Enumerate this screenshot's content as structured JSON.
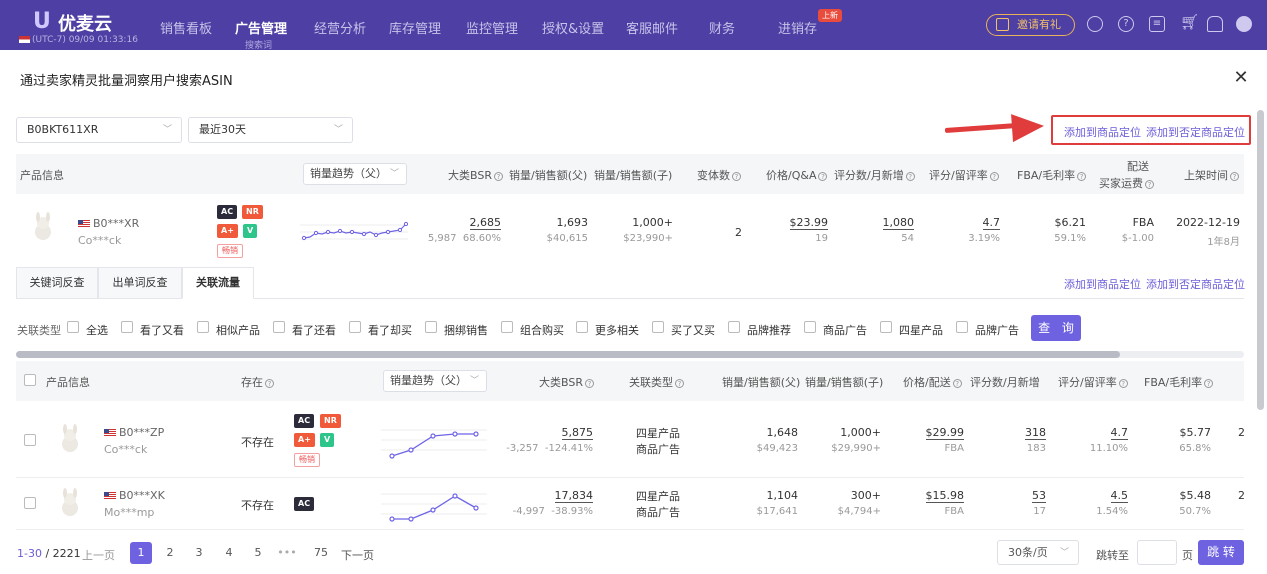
{
  "nav": {
    "brand": "优麦云",
    "clock": "(UTC-7) 09/09 01:33:16",
    "items": [
      "销售看板",
      "广告管理",
      "经营分析",
      "库存管理",
      "监控管理",
      "授权&设置",
      "客服邮件",
      "财务",
      "进销存"
    ],
    "active_sub": "搜索词",
    "new_badge": "上新",
    "invite": "邀请有礼"
  },
  "modal": {
    "title": "通过卖家精灵批量洞察用户搜索ASIN",
    "asin_select": "B0BKT611XR",
    "range_select": "最近30天",
    "link_add": "添加到商品定位",
    "link_add_neg": "添加到否定商品定位"
  },
  "product_header": {
    "info": "产品信息",
    "trend": "销量趋势（父）",
    "bsr": "大类BSR",
    "sales_parent": "销量/销售额(父)",
    "sales_child": "销量/销售额(子)",
    "variants": "变体数",
    "price": "价格/Q&A",
    "reviews": "评分数/月新增",
    "rating": "评分/留评率",
    "fba": "FBA/毛利率",
    "ship_1": "配送",
    "ship_2": "买家运费",
    "date": "上架时间"
  },
  "product": {
    "id": "B0***XR",
    "brand": "Co***ck",
    "badges": [
      "AC",
      "NR",
      "A+",
      "V",
      "畅销"
    ],
    "bsr": "2,685",
    "bsr_delta": "5,987",
    "bsr_pct": "68.60%",
    "sales_parent": "1,693",
    "rev_parent": "$40,615",
    "sales_child": "1,000+",
    "rev_child": "$23,990+",
    "variants": "2",
    "price": "$23.99",
    "qa": "19",
    "reviews": "1,080",
    "reviews_new": "54",
    "rating": "4.7",
    "review_rate": "3.19%",
    "fba": "$6.21",
    "margin": "59.1%",
    "ship": "FBA",
    "ship_fee": "$-1.00",
    "date": "2022-12-19",
    "age": "1年8月"
  },
  "tabs": [
    "关键词反查",
    "出单词反查",
    "关联流量"
  ],
  "filters": {
    "label": "关联类型",
    "options": [
      "全选",
      "看了又看",
      "相似产品",
      "看了还看",
      "看了却买",
      "捆绑销售",
      "组合购买",
      "更多相关",
      "买了又买",
      "品牌推荐",
      "商品广告",
      "四星产品",
      "品牌广告"
    ],
    "query": "查 询"
  },
  "list_header": {
    "info": "产品信息",
    "exists": "存在",
    "trend": "销量趋势（父）",
    "bsr": "大类BSR",
    "rel": "关联类型",
    "sales_parent": "销量/销售额(父)",
    "sales_child": "销量/销售额(子)",
    "price": "价格/配送",
    "reviews": "评分数/月新增",
    "rating": "评分/留评率",
    "fba": "FBA/毛利率"
  },
  "rows": [
    {
      "id": "B0***ZP",
      "brand": "Co***ck",
      "exists": "不存在",
      "bsr": "5,875",
      "bsr_delta": "-3,257",
      "bsr_pct": "-124.41%",
      "rel1": "四星产品",
      "rel2": "商品广告",
      "sales_parent": "1,648",
      "rev_parent": "$49,423",
      "sales_child": "1,000+",
      "rev_child": "$29,990+",
      "price": "$29.99",
      "ship": "FBA",
      "reviews": "318",
      "reviews_new": "183",
      "rating": "4.7",
      "review_rate": "11.10%",
      "fba": "$5.77",
      "margin": "65.8%",
      "extra": "2"
    },
    {
      "id": "B0***XK",
      "brand": "Mo***mp",
      "exists": "不存在",
      "bsr": "17,834",
      "bsr_delta": "-4,997",
      "bsr_pct": "-38.93%",
      "rel1": "四星产品",
      "rel2": "商品广告",
      "sales_parent": "1,104",
      "rev_parent": "$17,641",
      "sales_child": "300+",
      "rev_child": "$4,794+",
      "price": "$15.98",
      "ship": "FBA",
      "reviews": "53",
      "reviews_new": "17",
      "rating": "4.5",
      "review_rate": "1.54%",
      "fba": "$5.48",
      "margin": "50.7%",
      "extra": "2"
    }
  ],
  "pager": {
    "range": "1-30",
    "total": "/ 2221",
    "prev": "上一页",
    "pages": [
      "1",
      "2",
      "3",
      "4",
      "5",
      "•••",
      "75"
    ],
    "next": "下一页",
    "size": "30条/页",
    "goto": "跳转至",
    "page_unit": "页",
    "jump": "跳 转"
  }
}
